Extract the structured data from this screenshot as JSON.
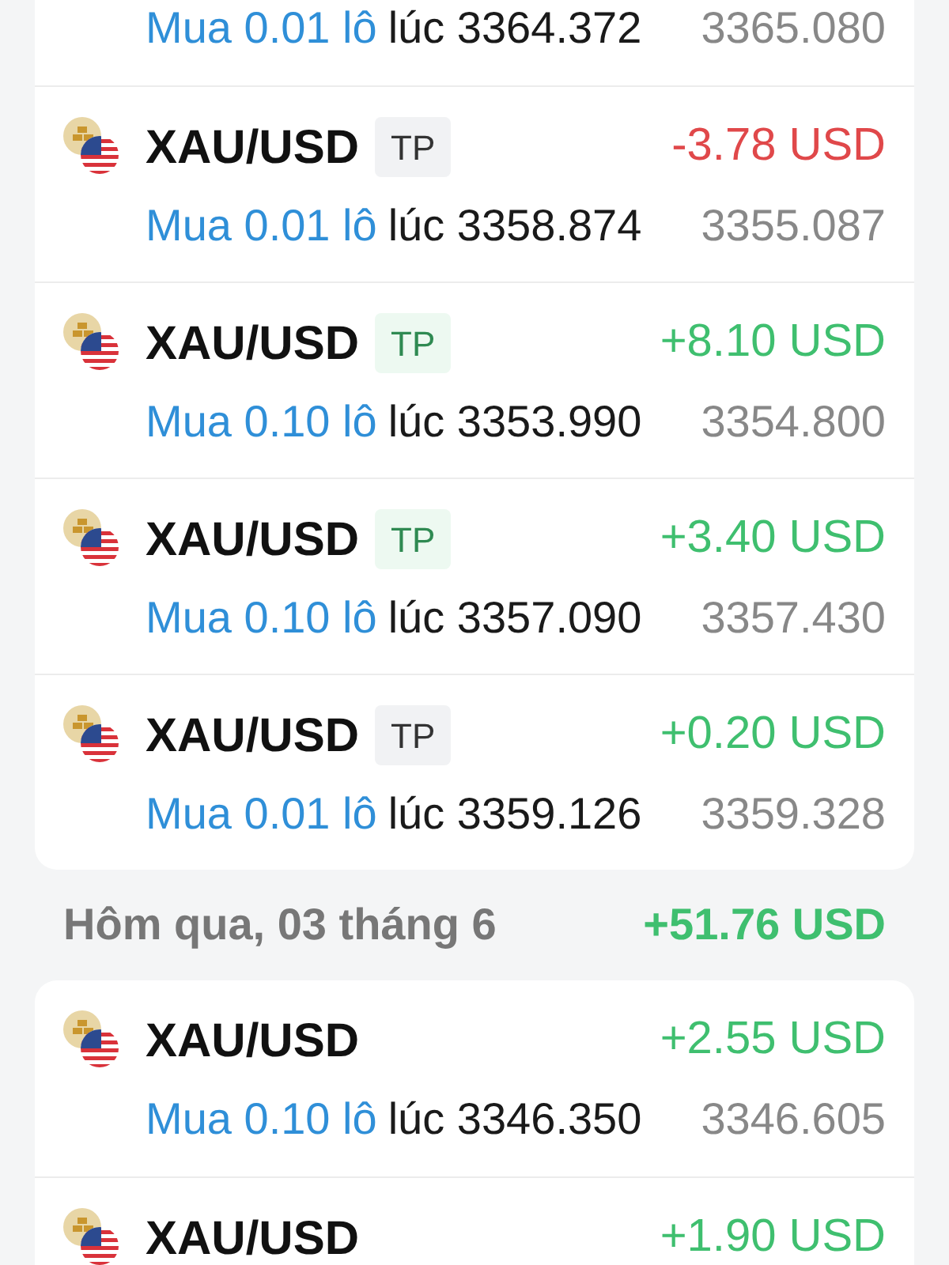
{
  "groups": [
    {
      "trades": [
        {
          "order": "Mua 0.01 lô",
          "open": "lúc 3364.372",
          "current": "3365.080"
        },
        {
          "symbol": "XAU/USD",
          "badge": {
            "label": "TP",
            "kind": "neutral"
          },
          "profit": "-3.78 USD",
          "color": "#e0484a",
          "order": "Mua 0.01 lô",
          "open": "lúc 3358.874",
          "current": "3355.087"
        },
        {
          "symbol": "XAU/USD",
          "badge": {
            "label": "TP",
            "kind": "positive"
          },
          "profit": "+8.10 USD",
          "color": "#3fbf6f",
          "order": "Mua 0.10 lô",
          "open": "lúc 3353.990",
          "current": "3354.800"
        },
        {
          "symbol": "XAU/USD",
          "badge": {
            "label": "TP",
            "kind": "positive"
          },
          "profit": "+3.40 USD",
          "color": "#3fbf6f",
          "order": "Mua 0.10 lô",
          "open": "lúc 3357.090",
          "current": "3357.430"
        },
        {
          "symbol": "XAU/USD",
          "badge": {
            "label": "TP",
            "kind": "neutral"
          },
          "profit": "+0.20 USD",
          "color": "#3fbf6f",
          "order": "Mua 0.01 lô",
          "open": "lúc 3359.126",
          "current": "3359.328"
        }
      ]
    },
    {
      "date": "Hôm qua, 03 tháng 6",
      "total": "+51.76 USD",
      "trades": [
        {
          "symbol": "XAU/USD",
          "profit": "+2.55 USD",
          "color": "#3fbf6f",
          "order": "Mua 0.10 lô",
          "open": "lúc 3346.350",
          "current": "3346.605"
        },
        {
          "symbol": "XAU/USD",
          "profit": "+1.90 USD",
          "color": "#3fbf6f"
        }
      ]
    }
  ]
}
